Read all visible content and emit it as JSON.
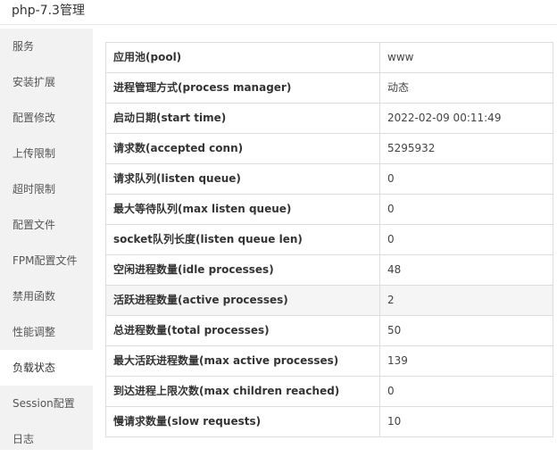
{
  "window": {
    "title": "php-7.3管理"
  },
  "sidebar": {
    "items": [
      {
        "label": "服务",
        "active": false
      },
      {
        "label": "安装扩展",
        "active": false
      },
      {
        "label": "配置修改",
        "active": false
      },
      {
        "label": "上传限制",
        "active": false
      },
      {
        "label": "超时限制",
        "active": false
      },
      {
        "label": "配置文件",
        "active": false
      },
      {
        "label": "FPM配置文件",
        "active": false
      },
      {
        "label": "禁用函数",
        "active": false
      },
      {
        "label": "性能调整",
        "active": false
      },
      {
        "label": "负载状态",
        "active": true
      },
      {
        "label": "Session配置",
        "active": false
      },
      {
        "label": "日志",
        "active": false
      }
    ]
  },
  "status_table": {
    "rows": [
      {
        "label": "应用池(pool)",
        "value": "www"
      },
      {
        "label": "进程管理方式(process manager)",
        "value": "动态"
      },
      {
        "label": "启动日期(start time)",
        "value": "2022-02-09 00:11:49"
      },
      {
        "label": "请求数(accepted conn)",
        "value": "5295932"
      },
      {
        "label": "请求队列(listen queue)",
        "value": "0"
      },
      {
        "label": "最大等待队列(max listen queue)",
        "value": "0"
      },
      {
        "label": "socket队列长度(listen queue len)",
        "value": "0"
      },
      {
        "label": "空闲进程数量(idle processes)",
        "value": "48"
      },
      {
        "label": "活跃进程数量(active processes)",
        "value": "2"
      },
      {
        "label": "总进程数量(total processes)",
        "value": "50"
      },
      {
        "label": "最大活跃进程数量(max active processes)",
        "value": "139"
      },
      {
        "label": "到达进程上限次数(max children reached)",
        "value": "0"
      },
      {
        "label": "慢请求数量(slow requests)",
        "value": "10"
      }
    ]
  }
}
